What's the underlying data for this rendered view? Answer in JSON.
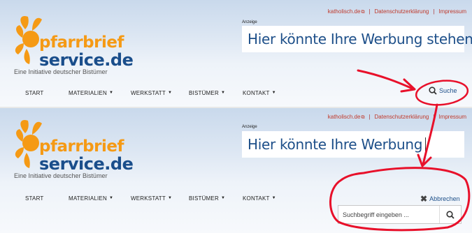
{
  "top_links": {
    "katholisch": "katholisch.de",
    "datenschutz": "Datenschutzerklärung",
    "impressum": "Impressum"
  },
  "ad": {
    "label": "Anzeige",
    "text_full": "Hier könnte Ihre Werbung stehen",
    "text_typing": "Hier könnte Ihre Werbung"
  },
  "logo": {
    "line1": "pfarrbrief",
    "line2": "service.de",
    "tagline": "Eine Initiative deutscher Bistümer"
  },
  "nav": [
    "START",
    "MATERIALIEN",
    "WERKSTATT",
    "BISTÜMER",
    "KONTAKT"
  ],
  "search": {
    "toggle_label": "Suche",
    "cancel_label": "Abbrechen",
    "placeholder": "Suchbegriff eingeben ..."
  },
  "colors": {
    "brand_orange": "#f59a15",
    "brand_blue": "#1a4e8b",
    "link_red": "#c0392b",
    "annotation_red": "#e8102a"
  }
}
